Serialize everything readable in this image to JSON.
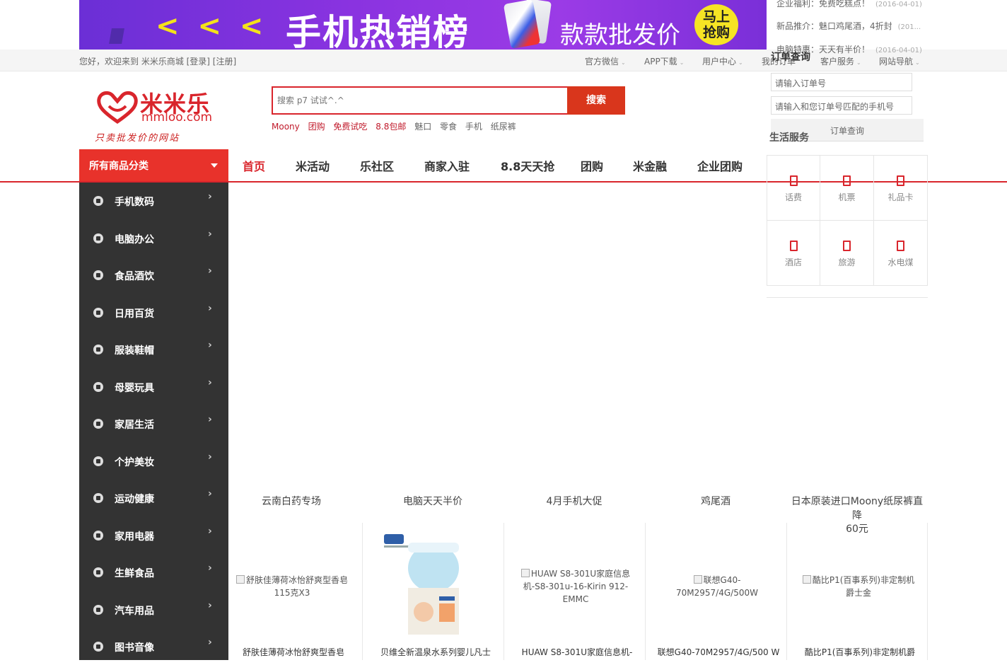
{
  "banner": {
    "arrows": "< < <",
    "title": "手机热销榜",
    "subtitle": "款款批发价",
    "badge_line1": "马上",
    "badge_line2": "抢购"
  },
  "notices": [
    {
      "text": "企业福利：免费吃糕点！",
      "date": "(2016-04-01)"
    },
    {
      "text": "新品推介：魅口鸡尾酒，4折封",
      "date": "(201..."
    },
    {
      "text": "电脑特惠：天天有半价！",
      "date": "(2016-04-01)"
    }
  ],
  "topbar": {
    "welcome": "您好，欢迎来到 米米乐商城 [登录] [注册]",
    "links": [
      "官方微信",
      "APP下载",
      "用户中心",
      "我的订单",
      "客户服务",
      "网站导航"
    ]
  },
  "logo": {
    "brand": "米米乐",
    "url": "mmloo.com",
    "slogan": "只卖批发价的网站"
  },
  "search": {
    "placeholder": "搜索 p7 试试^.^",
    "button": "搜索",
    "hotwords": [
      {
        "label": "Moony",
        "hot": true
      },
      {
        "label": "团购",
        "hot": true
      },
      {
        "label": "免费试吃",
        "hot": true
      },
      {
        "label": "8.8包邮",
        "hot": true
      },
      {
        "label": "魅口",
        "hot": false
      },
      {
        "label": "零食",
        "hot": false
      },
      {
        "label": "手机",
        "hot": false
      },
      {
        "label": "纸尿裤",
        "hot": false
      }
    ]
  },
  "order_query": {
    "title": "订单查询",
    "order_no_placeholder": "请输入订单号",
    "phone_placeholder": "请输入和您订单号匹配的手机号",
    "button": "订单查询"
  },
  "life_services": {
    "title": "生活服务",
    "items": [
      "话费",
      "机票",
      "礼品卡",
      "酒店",
      "旅游",
      "水电煤"
    ]
  },
  "nav": {
    "all_categories": "所有商品分类",
    "items": [
      "首页",
      "米活动",
      "乐社区",
      "商家入驻",
      "8.8天天抢",
      "团购",
      "米金融",
      "企业团购"
    ],
    "active": "首页"
  },
  "categories": [
    "手机数码",
    "电脑办公",
    "食品酒饮",
    "日用百货",
    "服装鞋帽",
    "母婴玩具",
    "家居生活",
    "个护美妆",
    "运动健康",
    "家用电器",
    "生鲜食品",
    "汽车用品",
    "图书音像"
  ],
  "promos": [
    "云南白药专场",
    "电脑天天半价",
    "4月手机大促",
    "鸡尾酒",
    "日本原装进口Moony纸尿裤直降",
    "60元"
  ],
  "products": [
    {
      "alt": "舒肤佳薄荷冰怡舒爽型香皂115克X3",
      "name": "舒肤佳薄荷冰怡舒爽型香皂"
    },
    {
      "alt": "",
      "name": "贝维全新温泉水系列婴儿凡士"
    },
    {
      "alt": "HUAW S8-301U家庭信息机-S8-301u-16-Kirin 912-EMMC",
      "name": "HUAW S8-301U家庭信息机-"
    },
    {
      "alt": "联想G40-70M2957/4G/500W",
      "name": "联想G40-70M2957/4G/500 W"
    },
    {
      "alt": "酷比P1(百事系列)非定制机爵士金",
      "name": "酷比P1(百事系列)非定制机爵"
    }
  ]
}
